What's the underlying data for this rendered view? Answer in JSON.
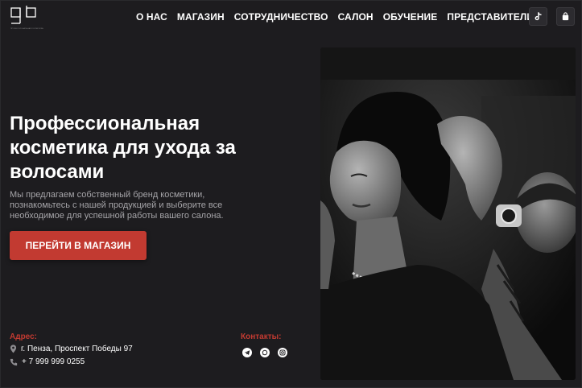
{
  "logo": {
    "mark": "gb",
    "subtitle": "ПРОФЕССИОНАЛЬНАЯ КОСМЕТИКА"
  },
  "nav": {
    "items": [
      "О НАС",
      "МАГАЗИН",
      "СОТРУДНИЧЕСТВО",
      "САЛОН",
      "ОБУЧЕНИЕ",
      "ПРЕДСТАВИТЕЛИ"
    ]
  },
  "header_icons": [
    "tiktok-icon",
    "shopping-bag-icon"
  ],
  "hero": {
    "title": "Профессиональная косметика для ухода за волосами",
    "description": "Мы предлагаем собственный бренд косметики, познакомьтесь с нашей продукцией и выберите все необходимое для успешной работы вашего салона.",
    "cta_label": "ПЕРЕЙТИ В МАГАЗИН"
  },
  "address": {
    "label": "Адрес:",
    "street": "г. Пенза, Проспект Победы 97",
    "phone": "+ 7 999 999 0255"
  },
  "contacts": {
    "label": "Контакты:",
    "socials": [
      "telegram-icon",
      "whatsapp-icon",
      "instagram-icon"
    ]
  },
  "colors": {
    "background": "#1d1c1f",
    "accent": "#c23a31",
    "muted_text": "#a5a4a8"
  }
}
